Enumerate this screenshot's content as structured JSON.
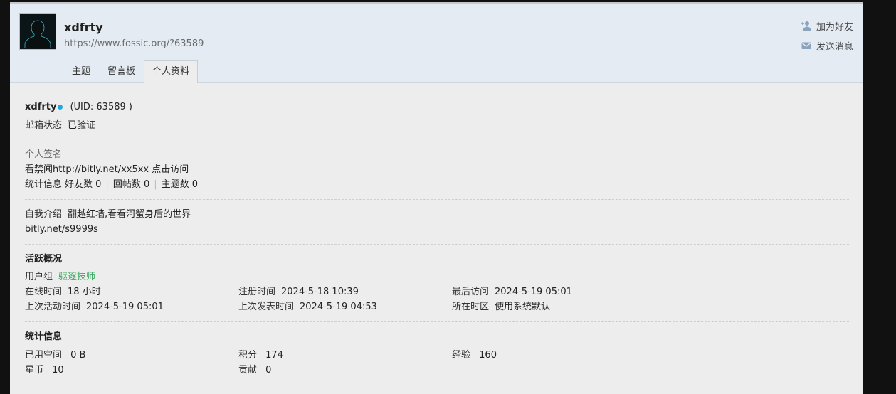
{
  "header": {
    "username": "xdfrty",
    "url": "https://www.fossic.org/?63589",
    "actions": {
      "add_friend": "加为好友",
      "send_message": "发送消息"
    },
    "tabs": [
      "主题",
      "留言板",
      "个人资料"
    ]
  },
  "profile": {
    "name": "xdfrty",
    "uid": "(UID: 63589 )",
    "email_label": "邮箱状态",
    "email_value": "已验证",
    "signature_label": "个人签名",
    "signature_value": "看禁闻http://bitly.net/xx5xx 点击访问",
    "stats_label": "统计信息",
    "friends": "好友数 0",
    "replies": "回帖数 0",
    "threads": "主题数 0",
    "intro_label": "自我介绍",
    "intro_value": "翻越红墙,看看河蟹身后的世界",
    "intro_link": "bitly.net/s9999s"
  },
  "activity": {
    "title": "活跃概况",
    "group_label": "用户组",
    "group_value": "驱逐技师",
    "online_label": "在线时间",
    "online_value": "18 小时",
    "reg_label": "注册时间",
    "reg_value": "2024-5-18 10:39",
    "last_visit_label": "最后访问",
    "last_visit_value": "2024-5-19 05:01",
    "last_active_label": "上次活动时间",
    "last_active_value": "2024-5-19 05:01",
    "last_post_label": "上次发表时间",
    "last_post_value": "2024-5-19 04:53",
    "tz_label": "所在时区",
    "tz_value": "使用系统默认"
  },
  "statistics": {
    "title": "统计信息",
    "space_label": "已用空间",
    "space_value": "0 B",
    "points_label": "积分",
    "points_value": "174",
    "exp_label": "经验",
    "exp_value": "160",
    "coins_label": "星币",
    "coins_value": "10",
    "contrib_label": "贡献",
    "contrib_value": "0"
  },
  "colors": {
    "accent": "#1ea8e0",
    "group": "#3aa85c",
    "header_bg": "#e4ebf3"
  },
  "icons": [
    "user-silhouette-avatar",
    "add-friend-icon",
    "mail-icon",
    "online-dot"
  ]
}
